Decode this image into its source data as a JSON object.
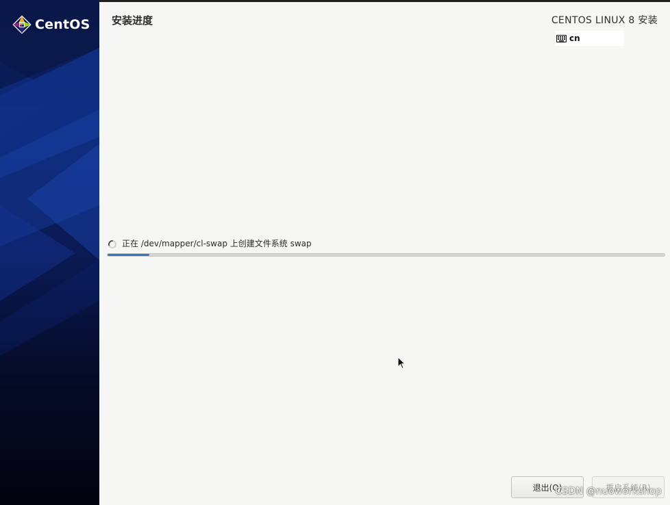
{
  "sidebar": {
    "logo_text": "CentOS"
  },
  "header": {
    "page_title": "安装进度",
    "product_title": "CENTOS LINUX 8 安装",
    "keyboard_layout": "cn"
  },
  "progress": {
    "status_text": "正在 /dev/mapper/cl-swap 上创建文件系统 swap",
    "fraction": 0.075,
    "fill_color": "#3872c1"
  },
  "buttons": {
    "quit_label": "退出(Q)",
    "reboot_label": "重启系统(R)"
  },
  "watermark": "CSDN @nuoworkshop",
  "icons": {
    "logo": "centos-logo-icon",
    "keyboard": "keyboard-icon",
    "spinner": "spinner-icon",
    "cursor": "mouse-pointer-icon"
  }
}
